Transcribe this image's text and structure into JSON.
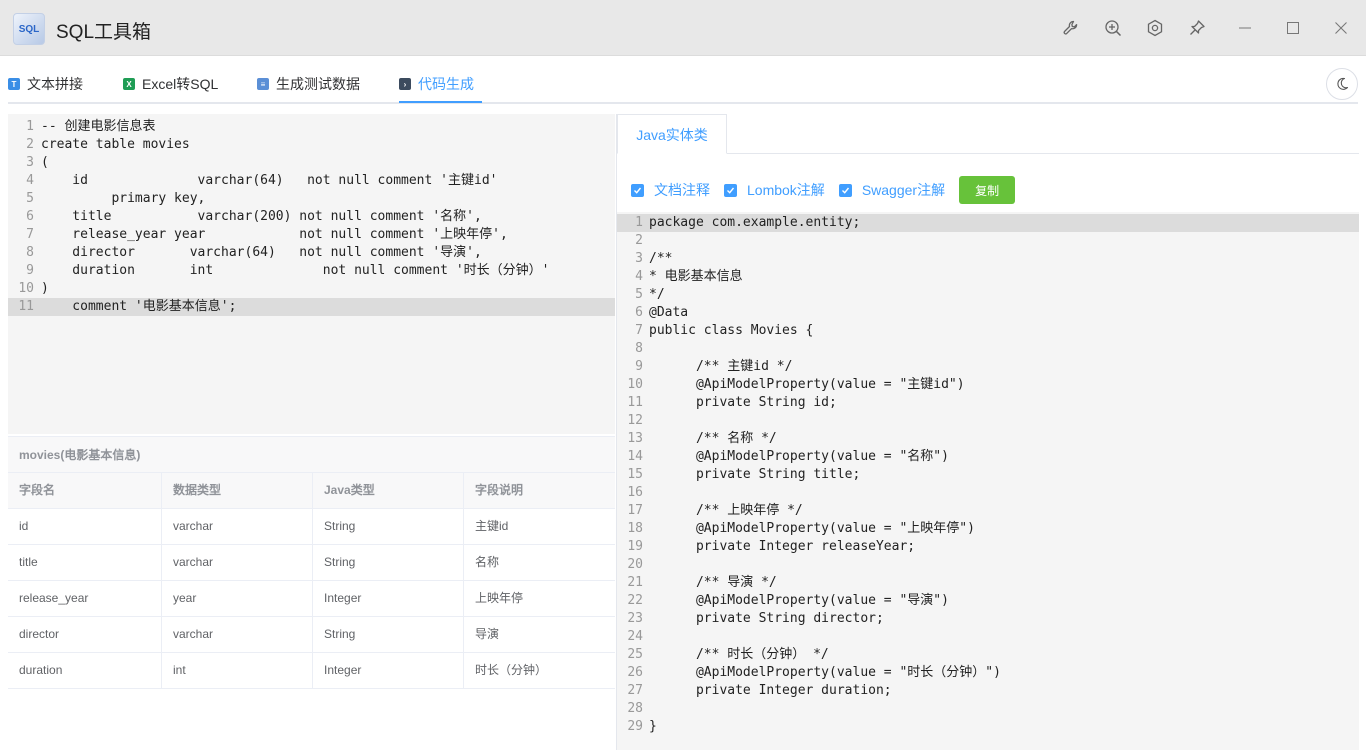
{
  "app": {
    "title": "SQL工具箱",
    "logo_text": "SQL"
  },
  "window_controls": [
    "wrench-icon",
    "zoom-in-icon",
    "settings-icon",
    "pin-icon",
    "minimize-icon",
    "maximize-icon",
    "close-icon"
  ],
  "tabs": [
    {
      "label": "文本拼接",
      "icon": "text-icon",
      "active": false
    },
    {
      "label": "Excel转SQL",
      "icon": "excel-icon",
      "active": false
    },
    {
      "label": "生成测试数据",
      "icon": "data-icon",
      "active": false
    },
    {
      "label": "代码生成",
      "icon": "code-icon",
      "active": true
    }
  ],
  "sql_editor": {
    "line_numbers": [
      "1",
      "2",
      "3",
      "4",
      "5",
      "6",
      "7",
      "8",
      "9",
      "10",
      "11"
    ],
    "lines": [
      "-- 创建电影信息表",
      "create table movies",
      "(",
      "    id              varchar(64)   not null comment '主键id'",
      "         primary key,",
      "    title           varchar(200) not null comment '名称',",
      "    release_year year            not null comment '上映年停',",
      "    director       varchar(64)   not null comment '导演',",
      "    duration       int              not null comment '时长（分钟）'",
      ")",
      "    comment '电影基本信息';"
    ]
  },
  "table_info": {
    "title": "movies(电影基本信息)",
    "columns": [
      "字段名",
      "数据类型",
      "Java类型",
      "字段说明"
    ],
    "rows": [
      [
        "id",
        "varchar",
        "String",
        "主键id"
      ],
      [
        "title",
        "varchar",
        "String",
        "名称"
      ],
      [
        "release_year",
        "year",
        "Integer",
        "上映年停"
      ],
      [
        "director",
        "varchar",
        "String",
        "导演"
      ],
      [
        "duration",
        "int",
        "Integer",
        "时长（分钟）"
      ]
    ]
  },
  "right_panel": {
    "tab": "Java实体类",
    "options": [
      {
        "label": "文档注释",
        "checked": true
      },
      {
        "label": "Lombok注解",
        "checked": true
      },
      {
        "label": "Swagger注解",
        "checked": true
      }
    ],
    "copy_label": "复制"
  },
  "java_editor": {
    "line_numbers": [
      "1",
      "2",
      "3",
      "4",
      "5",
      "6",
      "7",
      "8",
      "9",
      "10",
      "11",
      "12",
      "13",
      "14",
      "15",
      "16",
      "17",
      "18",
      "19",
      "20",
      "21",
      "22",
      "23",
      "24",
      "25",
      "26",
      "27",
      "28",
      "29"
    ],
    "lines": [
      "package com.example.entity;",
      "",
      "/**",
      "* 电影基本信息",
      "*/",
      "@Data",
      "public class Movies {",
      "",
      "      /** 主键id */",
      "      @ApiModelProperty(value = \"主键id\")",
      "      private String id;",
      "",
      "      /** 名称 */",
      "      @ApiModelProperty(value = \"名称\")",
      "      private String title;",
      "",
      "      /** 上映年停 */",
      "      @ApiModelProperty(value = \"上映年停\")",
      "      private Integer releaseYear;",
      "",
      "      /** 导演 */",
      "      @ApiModelProperty(value = \"导演\")",
      "      private String director;",
      "",
      "      /** 时长（分钟） */",
      "      @ApiModelProperty(value = \"时长（分钟）\")",
      "      private Integer duration;",
      "",
      "}"
    ]
  },
  "colors": {
    "accent": "#409eff",
    "copy_button": "#67c23a",
    "editor_bg": "#f5f5f5"
  }
}
